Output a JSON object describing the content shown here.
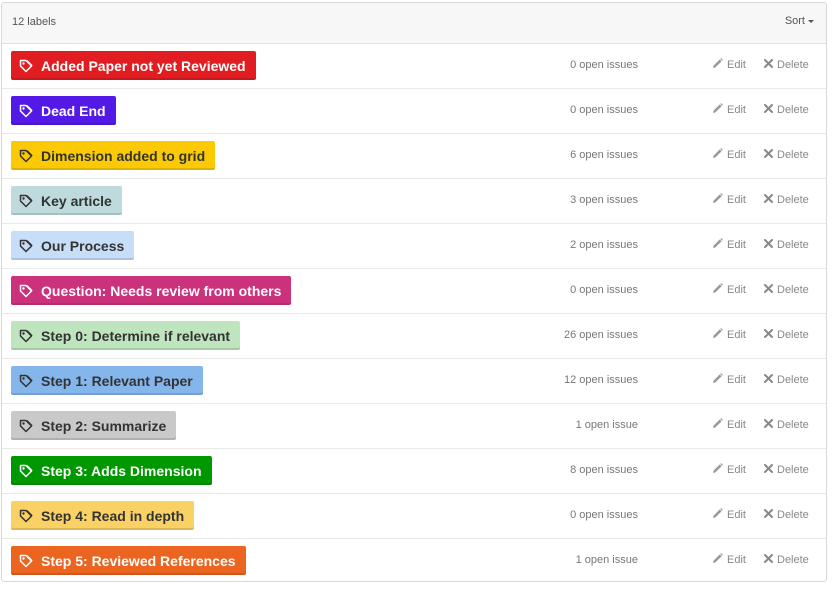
{
  "header": {
    "label_count": "12 labels",
    "sort_label": "Sort"
  },
  "actions": {
    "edit_label": "Edit",
    "delete_label": "Delete"
  },
  "labels": [
    {
      "name": "Added Paper not yet Reviewed",
      "issues": "0 open issues",
      "bg": "#e11d21",
      "fg": "#ffffff"
    },
    {
      "name": "Dead End",
      "issues": "0 open issues",
      "bg": "#5319e7",
      "fg": "#ffffff"
    },
    {
      "name": "Dimension added to grid",
      "issues": "6 open issues",
      "bg": "#fbca04",
      "fg": "#333333"
    },
    {
      "name": "Key article",
      "issues": "3 open issues",
      "bg": "#bfdadc",
      "fg": "#333333"
    },
    {
      "name": "Our Process",
      "issues": "2 open issues",
      "bg": "#c7def8",
      "fg": "#333333"
    },
    {
      "name": "Question: Needs review from others",
      "issues": "0 open issues",
      "bg": "#cc317c",
      "fg": "#ffffff"
    },
    {
      "name": "Step 0: Determine if relevant",
      "issues": "26 open issues",
      "bg": "#bfe5bf",
      "fg": "#333333"
    },
    {
      "name": "Step 1: Relevant Paper",
      "issues": "12 open issues",
      "bg": "#84b6eb",
      "fg": "#333333"
    },
    {
      "name": "Step 2: Summarize",
      "issues": "1 open issue",
      "bg": "#c9c9c9",
      "fg": "#333333"
    },
    {
      "name": "Step 3: Adds Dimension",
      "issues": "8 open issues",
      "bg": "#009800",
      "fg": "#ffffff"
    },
    {
      "name": "Step 4: Read in depth",
      "issues": "0 open issues",
      "bg": "#fad165",
      "fg": "#333333"
    },
    {
      "name": "Step 5: Reviewed References",
      "issues": "1 open issue",
      "bg": "#eb6420",
      "fg": "#ffffff"
    }
  ]
}
